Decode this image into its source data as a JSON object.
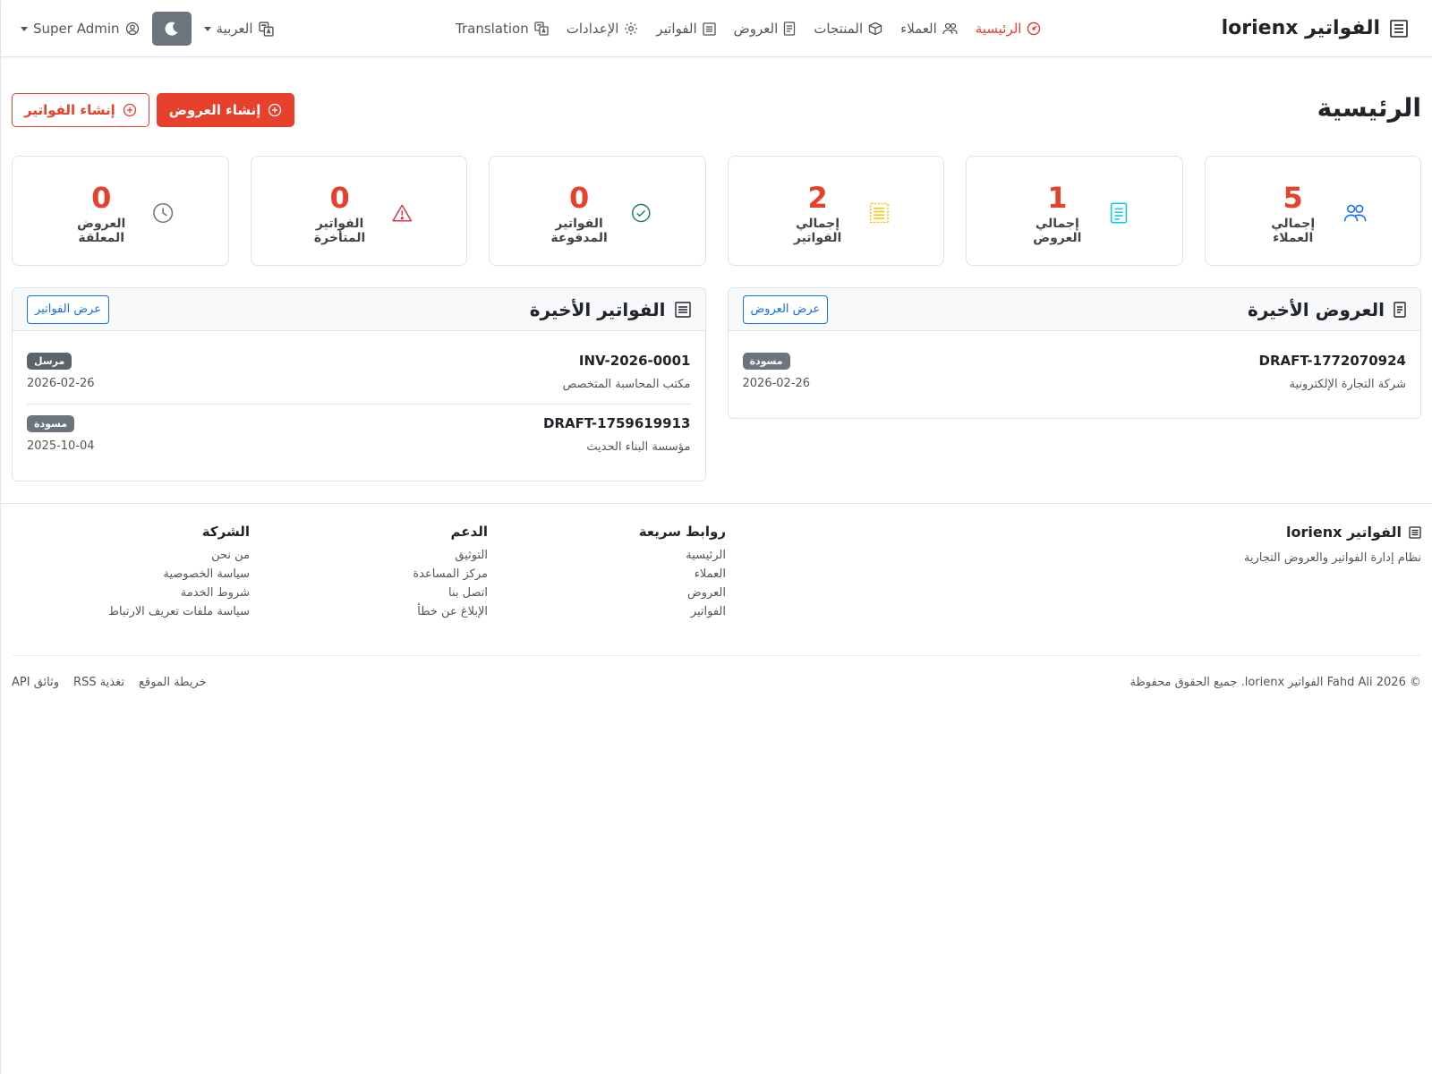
{
  "navbar": {
    "brand": "الفواتير lorienx",
    "links": [
      {
        "label": "الرئيسية",
        "icon": "dashboard-icon",
        "active": true
      },
      {
        "label": "العملاء",
        "icon": "users-icon"
      },
      {
        "label": "المنتجات",
        "icon": "box-icon"
      },
      {
        "label": "العروض",
        "icon": "document-icon"
      },
      {
        "label": "الفواتير",
        "icon": "receipt-icon"
      },
      {
        "label": "الإعدادات",
        "icon": "gear-icon"
      },
      {
        "label": "Translation",
        "icon": "translate-icon"
      }
    ],
    "language": "العربية",
    "user": "Super Admin"
  },
  "page": {
    "title": "الرئيسية",
    "create_quote_label": "إنشاء العروض",
    "create_invoice_label": "إنشاء الفواتير"
  },
  "stats": [
    {
      "value": "5",
      "label": "إجمالي العملاء",
      "icon": "users-icon",
      "color": "#0d6efd"
    },
    {
      "value": "1",
      "label": "إجمالي العروض",
      "icon": "document-icon",
      "color": "#0dcaf0"
    },
    {
      "value": "2",
      "label": "إجمالي الفواتير",
      "icon": "receipt-icon",
      "color": "#ffc107"
    },
    {
      "value": "0",
      "label": "الفواتير المدفوعة",
      "icon": "check-circle-icon",
      "color": "#198754"
    },
    {
      "value": "0",
      "label": "الفواتير المتأخرة",
      "icon": "warning-icon",
      "color": "#dc3545"
    },
    {
      "value": "0",
      "label": "العروض المعلقة",
      "icon": "clock-icon",
      "color": "#6c757d"
    }
  ],
  "recent_quotes": {
    "title": "العروض الأخيرة",
    "view_label": "عرض العروض",
    "items": [
      {
        "number": "DRAFT-1772070924",
        "client": "شركة التجارة الإلكترونية",
        "status": "مسودة",
        "date": "2026-02-26"
      }
    ]
  },
  "recent_invoices": {
    "title": "الفواتير الأخيرة",
    "view_label": "عرض الفواتير",
    "items": [
      {
        "number": "INV-2026-0001",
        "client": "مكتب المحاسبة المتخصص",
        "status": "مرسل",
        "date": "2026-02-26"
      },
      {
        "number": "DRAFT-1759619913",
        "client": "مؤسسة البناء الحديث",
        "status": "مسودة",
        "date": "2025-10-04"
      }
    ]
  },
  "footer": {
    "brand": "الفواتير lorienx",
    "description": "نظام إدارة الفواتير والعروض التجارية",
    "columns": [
      {
        "title": "روابط سريعة",
        "links": [
          "الرئيسية",
          "العملاء",
          "العروض",
          "الفواتير"
        ]
      },
      {
        "title": "الدعم",
        "links": [
          "التوثيق",
          "مركز المساعدة",
          "اتصل بنا",
          "الإبلاغ عن خطأ"
        ]
      },
      {
        "title": "الشركة",
        "links": [
          "من نحن",
          "سياسة الخصوصية",
          "شروط الخدمة",
          "سياسة ملفات تعريف الارتباط"
        ]
      }
    ],
    "copyright": "© 2026 Fahd Ali الفواتير lorienx. جميع الحقوق محفوظة",
    "bottom_links": [
      "خريطة الموقع",
      "تغذية RSS",
      "وثائق API"
    ]
  },
  "colors": {
    "accent": "#e8412b",
    "primary": "#0d6efd",
    "badge": "#6c757d"
  }
}
